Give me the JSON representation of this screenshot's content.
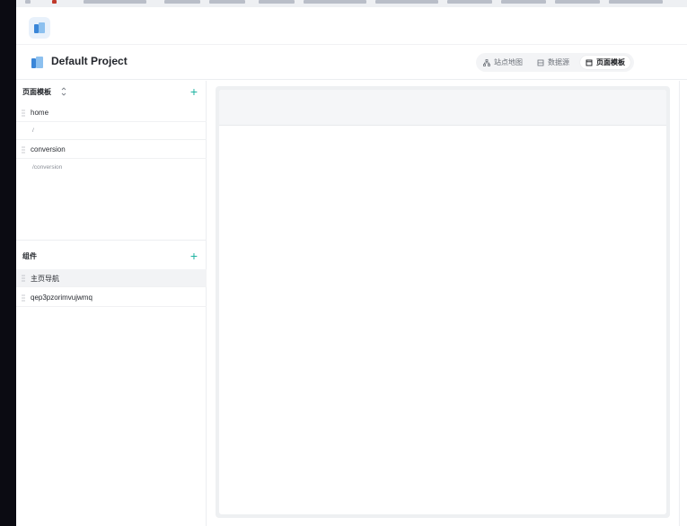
{
  "project": {
    "title": "Default Project"
  },
  "tabs": [
    {
      "label": "站点地图",
      "icon": "sitemap-icon",
      "active": false
    },
    {
      "label": "数据源",
      "icon": "database-icon",
      "active": false
    },
    {
      "label": "页面模板",
      "icon": "template-icon",
      "active": true
    }
  ],
  "pages": {
    "title": "页面模板",
    "items": [
      {
        "label": "home",
        "path": "/"
      },
      {
        "label": "conversion",
        "path": "/conversion"
      }
    ]
  },
  "components": {
    "title": "组件",
    "items": [
      {
        "label": "主页导航",
        "selected": true
      },
      {
        "label": "qep3pzorimvujwmq",
        "selected": false
      }
    ]
  },
  "colors": {
    "accent": "#1fb3a2",
    "logo_blue": "#3a86d8",
    "logo_light": "#8cc0ef"
  }
}
